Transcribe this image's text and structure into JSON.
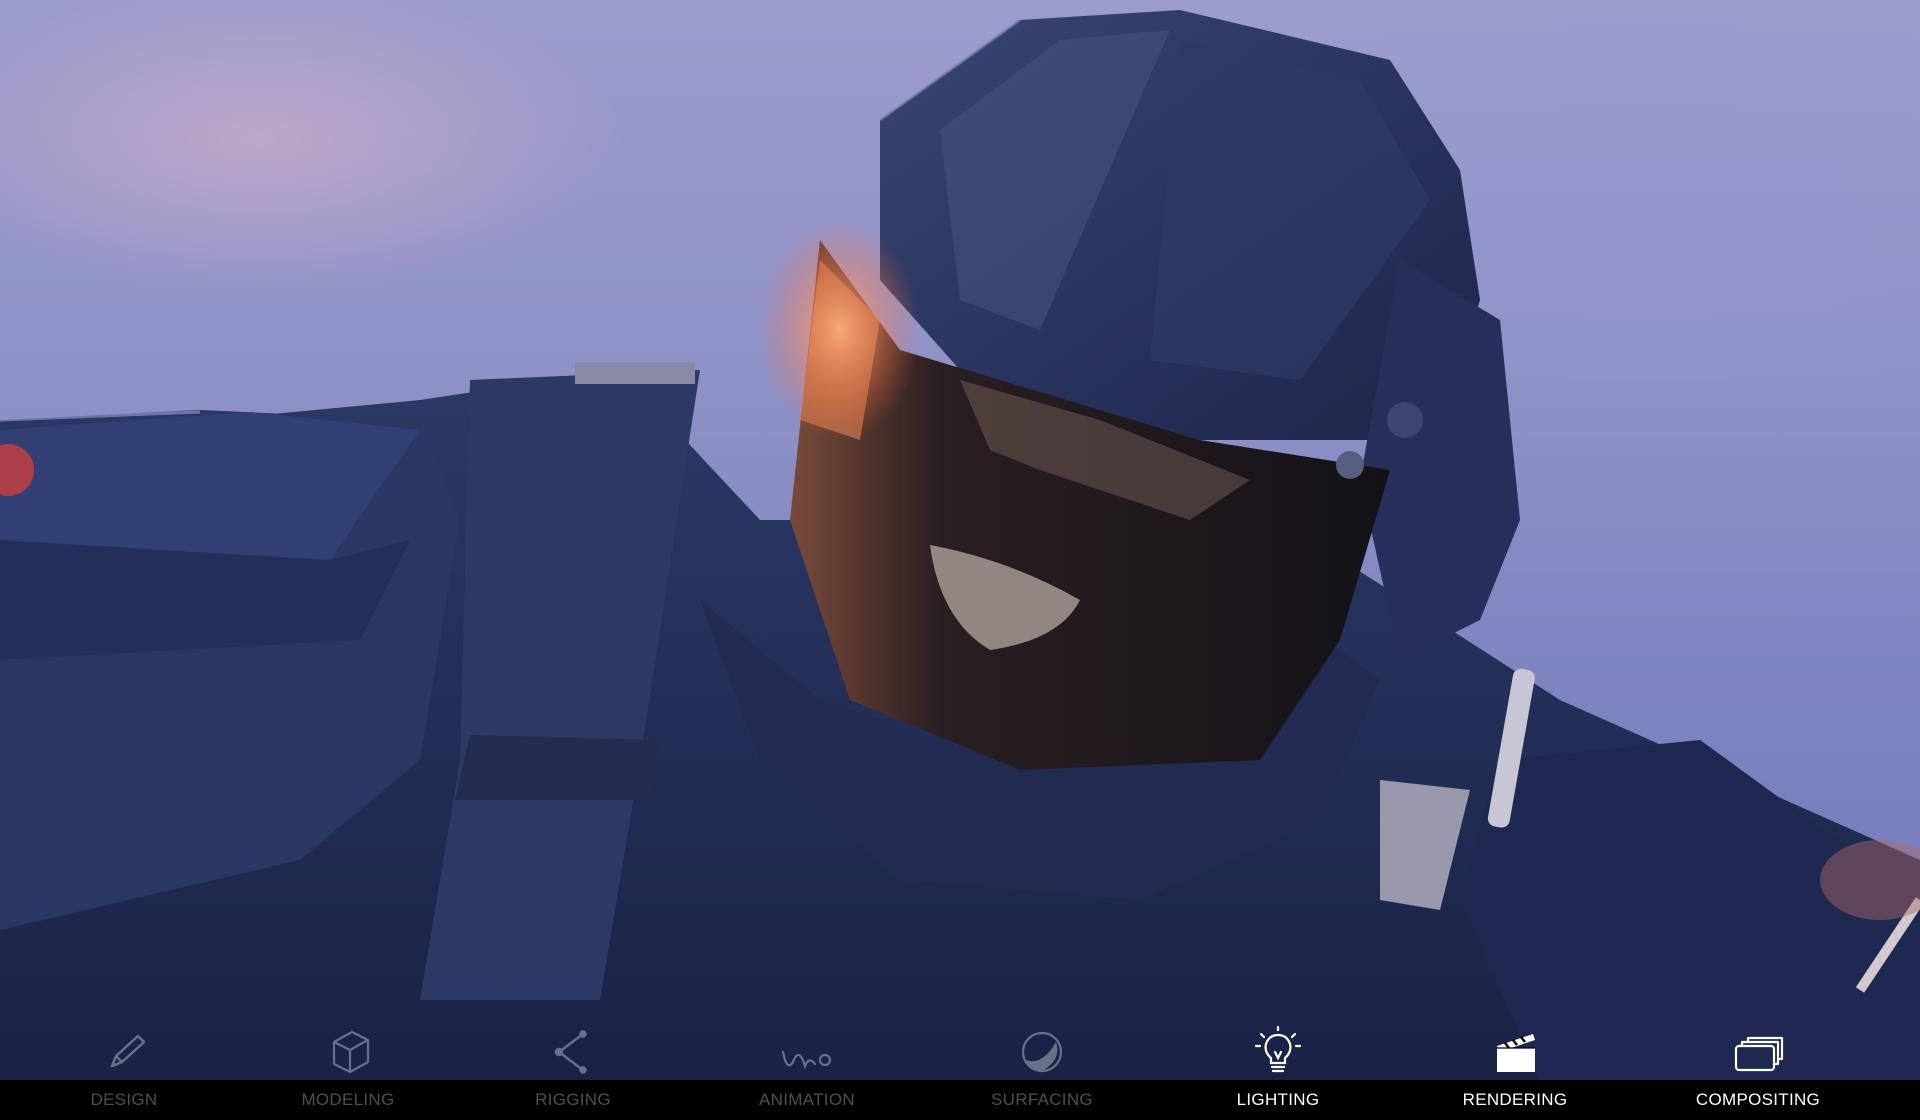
{
  "pipeline": {
    "stages": [
      {
        "label": "DESIGN",
        "icon": "pencil-icon",
        "active": false
      },
      {
        "label": "MODELING",
        "icon": "cube-icon",
        "active": false
      },
      {
        "label": "RIGGING",
        "icon": "bone-joint-icon",
        "active": false
      },
      {
        "label": "ANIMATION",
        "icon": "bouncing-ball-icon",
        "active": false
      },
      {
        "label": "SURFACING",
        "icon": "shaded-sphere-icon",
        "active": false
      },
      {
        "label": "LIGHTING",
        "icon": "light-bulb-icon",
        "active": true
      },
      {
        "label": "RENDERING",
        "icon": "clapperboard-icon",
        "active": true
      },
      {
        "label": "COMPOSITING",
        "icon": "stacked-layers-icon",
        "active": true
      }
    ]
  },
  "colors": {
    "active_label": "#ffffff",
    "inactive_label": "#4e4e58",
    "bar_background": "#000000"
  }
}
